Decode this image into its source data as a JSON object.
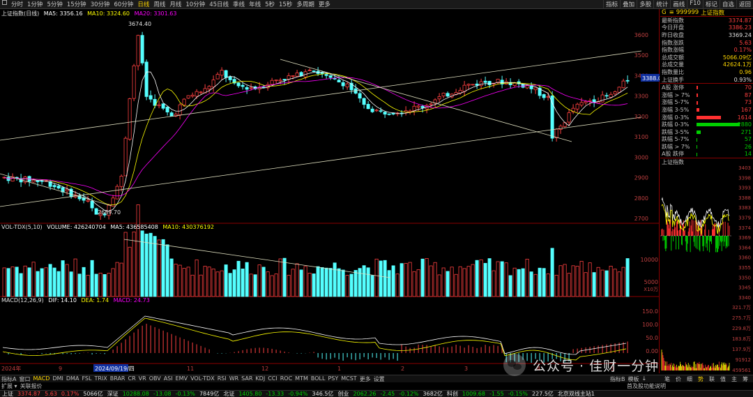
{
  "toolbar": {
    "left_items": [
      "分时",
      "1分钟",
      "5分钟",
      "15分钟",
      "30分钟",
      "60分钟",
      "日线",
      "周线",
      "月线",
      "10分钟",
      "45日线",
      "季线",
      "年线",
      "5秒",
      "15秒",
      "多周期",
      "更多"
    ],
    "right_items": [
      "指标",
      "叠加",
      "多股",
      "统计",
      "画线",
      "F10",
      "标记",
      "自选",
      "返回"
    ],
    "active": "日线"
  },
  "main_chart": {
    "legend_name": "上证指数(日线)",
    "ma5": "MA5: 3356.16",
    "ma10": "MA10: 3324.60",
    "ma20": "MA20: 3301.63",
    "high_label": "3674.40",
    "low_label": "2689.70",
    "price_label": "3388.0",
    "axis": [
      "3600",
      "3500",
      "3400",
      "3300",
      "3200",
      "3100",
      "3000",
      "2900",
      "2800",
      "2700"
    ]
  },
  "volume_chart": {
    "legend": "VOL-TDX(5,10)",
    "volume": "VOLUME: 426240704",
    "ma5": "MA5: 436585408",
    "ma10": "MA10: 430376192",
    "axis": [
      "10000",
      "5000"
    ],
    "unit": "X10万"
  },
  "macd_chart": {
    "legend": "MACD(12,26,9)",
    "dif": "DIF: 14.10",
    "dea": "DEA: 1.74",
    "macd": "MACD: 24.73",
    "axis": [
      "150.0",
      "100.0",
      "50.0",
      "0.00"
    ]
  },
  "x_axis": {
    "year": "2024年",
    "labels": [
      "9",
      "2024/09/19/四",
      "11",
      "12",
      "1",
      "2",
      "3",
      "4",
      "5"
    ]
  },
  "right_panel": {
    "header_code": "999999",
    "header_name": "上证指数",
    "quote_rows": [
      {
        "label": "最新指数",
        "value": "3374.87",
        "color": "red"
      },
      {
        "label": "今日开盘",
        "value": "3386.23",
        "color": "red"
      },
      {
        "label": "昨日收盘",
        "value": "3369.24",
        "color": "white"
      },
      {
        "label": "指数涨跌",
        "value": "5.63",
        "color": "red"
      },
      {
        "label": "指数涨幅",
        "value": "0.17%",
        "color": "red"
      },
      {
        "label": "总成交额",
        "value": "5066.09亿",
        "color": "yellow"
      },
      {
        "label": "总成交量",
        "value": "42624.1万",
        "color": "yellow"
      },
      {
        "label": "指数量比",
        "value": "0.96",
        "color": "yellow"
      },
      {
        "label": "上证换手",
        "value": "0.93%",
        "color": "white"
      }
    ],
    "stat_rows": [
      {
        "label": "A股 涨停",
        "value": "70",
        "color": "red"
      },
      {
        "label": "涨幅 > 7%",
        "value": "87",
        "color": "red"
      },
      {
        "label": "涨幅 5-7%",
        "value": "73",
        "color": "red"
      },
      {
        "label": "涨幅 3-5%",
        "value": "167",
        "color": "red"
      },
      {
        "label": "涨幅 0-3%",
        "value": "1614",
        "color": "red"
      },
      {
        "label": "跌幅 0-3%",
        "value": "2880",
        "color": "green"
      },
      {
        "label": "跌幅 3-5%",
        "value": "271",
        "color": "green"
      },
      {
        "label": "跌幅 5-7%",
        "value": "57",
        "color": "green"
      },
      {
        "label": "跌幅 > 7%",
        "value": "26",
        "color": "green"
      },
      {
        "label": "A股 跌停",
        "value": "14",
        "color": "green"
      }
    ],
    "stat_bar_counts": [
      70,
      87,
      73,
      167,
      1614,
      2880,
      271,
      57,
      26,
      14
    ],
    "mini_title": "上证指数",
    "mini_axis_left": [
      "3403",
      "3398",
      "3393",
      "3388",
      "3383",
      "3379",
      "3374",
      "3369",
      "3364",
      "3360",
      "3355",
      "3350",
      "3345",
      "3340"
    ],
    "mini_vol_axis": [
      "321.7万",
      "275.7万",
      "229.8万",
      "183.8万",
      "137.9万",
      "91912",
      "459561"
    ],
    "bottom_tabs": [
      "笔",
      "价",
      "细",
      "势",
      "联",
      "值",
      "主",
      "筹"
    ],
    "bottom_tab_active": "势"
  },
  "bottom_tabs": {
    "items": [
      "指标A",
      "窗口",
      "MACD",
      "DMI",
      "DMA",
      "FSL",
      "TRIX",
      "BRAR",
      "CR",
      "VR",
      "OBV",
      "ASI",
      "EMV",
      "VOL-TDX",
      "RSI",
      "WR",
      "SAR",
      "KDJ",
      "CCI",
      "ROC",
      "MTM",
      "BOLL",
      "PSY",
      "MCST",
      "更多",
      "设置"
    ],
    "active": "MACD",
    "right_items": [
      "指标B",
      "模板",
      "↓"
    ],
    "right_extra": "首及股功能说明"
  },
  "bottom_tabs2": [
    "扩展 ▾",
    "关联报价"
  ],
  "status_bar": {
    "segments": [
      {
        "text": "上证",
        "color": "white"
      },
      {
        "text": "3374.87",
        "color": "red"
      },
      {
        "text": "5.63",
        "color": "red"
      },
      {
        "text": "0.17%",
        "color": "red"
      },
      {
        "text": "5066亿",
        "color": "white"
      },
      {
        "text": "深证",
        "color": "white"
      },
      {
        "text": "10288.08",
        "color": "green"
      },
      {
        "text": "-13.08",
        "color": "green"
      },
      {
        "text": "-0.13%",
        "color": "green"
      },
      {
        "text": "7849亿",
        "color": "white"
      },
      {
        "text": "北证",
        "color": "white"
      },
      {
        "text": "1405.80",
        "color": "green"
      },
      {
        "text": "-13.33",
        "color": "green"
      },
      {
        "text": "-0.94%",
        "color": "green"
      },
      {
        "text": "346.5亿",
        "color": "white"
      },
      {
        "text": "创业",
        "color": "white"
      },
      {
        "text": "2062.26",
        "color": "green"
      },
      {
        "text": "-2.45",
        "color": "green"
      },
      {
        "text": "-0.12%",
        "color": "green"
      },
      {
        "text": "3682亿",
        "color": "white"
      },
      {
        "text": "科创",
        "color": "white"
      },
      {
        "text": "1009.68",
        "color": "green"
      },
      {
        "text": "-1.55",
        "color": "green"
      },
      {
        "text": "-0.15%",
        "color": "green"
      },
      {
        "text": "227.5亿",
        "color": "white"
      },
      {
        "text": "北京双线主站1",
        "color": "white"
      }
    ]
  },
  "watermark": {
    "text": "公众号 · 佳财一分钟"
  },
  "colors": {
    "up": "#ff4040",
    "down": "#54ffff",
    "ma5": "#ffffff",
    "ma10": "#ffff00",
    "ma20": "#ff00ff",
    "accent": "#ffd700"
  }
}
